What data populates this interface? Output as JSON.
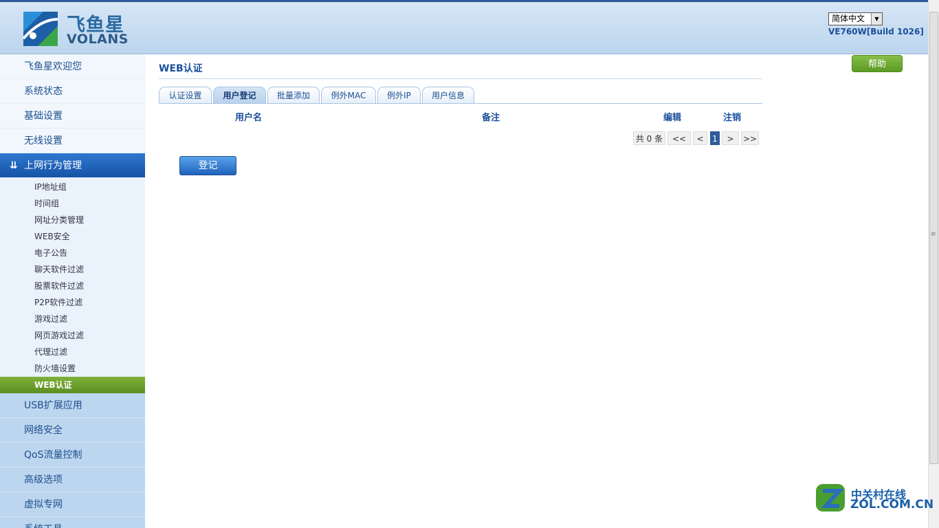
{
  "header": {
    "logo_cn": "飞鱼星",
    "logo_en": "VOLANS",
    "language": "简体中文",
    "build": "VE760W[Build 1026]",
    "help_label": "帮助"
  },
  "sidebar": {
    "top_items": [
      "飞鱼星欢迎您",
      "系统状态",
      "基础设置",
      "无线设置"
    ],
    "active_group": "上网行为管理",
    "sub_items": [
      "IP地址组",
      "时间组",
      "网址分类管理",
      "WEB安全",
      "电子公告",
      "聊天软件过滤",
      "股票软件过滤",
      "P2P软件过滤",
      "游戏过滤",
      "网页游戏过滤",
      "代理过滤",
      "防火墙设置",
      "WEB认证"
    ],
    "active_sub": "WEB认证",
    "lower_items": [
      "USB扩展应用",
      "网络安全",
      "QoS流量控制",
      "高级选项",
      "虚拟专网",
      "系统工具"
    ]
  },
  "main": {
    "title": "WEB认证",
    "tabs": [
      "认证设置",
      "用户登记",
      "批量添加",
      "例外MAC",
      "例外IP",
      "用户信息"
    ],
    "active_tab": "用户登记",
    "columns": [
      "用户名",
      "备注",
      "编辑",
      "注销"
    ],
    "pager": {
      "total": "共 0 条",
      "first": "<<",
      "prev": "<",
      "page": "1",
      "next": ">",
      "last": ">>"
    },
    "login_button": "登记"
  },
  "watermark": {
    "cn": "中关村在线",
    "en": "ZOL.COM.CN"
  },
  "colors": {
    "brand_blue": "#1a4f9c",
    "nav_active": "#1553a6",
    "sub_active_green": "#5c8f20",
    "help_green": "#5b9a26"
  }
}
